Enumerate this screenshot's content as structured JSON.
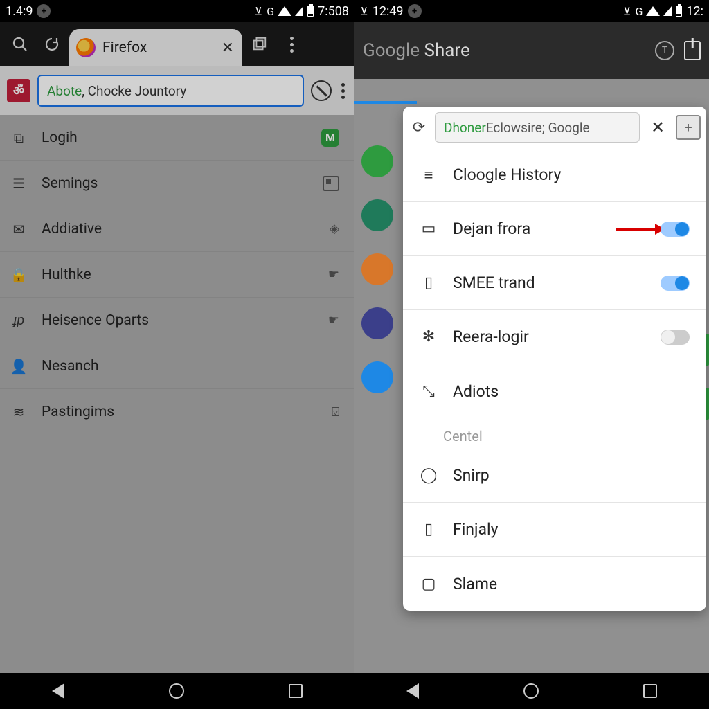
{
  "left": {
    "status": {
      "time_left": "1.4:9",
      "time_right": "7:508"
    },
    "tab": {
      "title": "Firefox"
    },
    "url": {
      "abote": "Abote",
      "rest": ", Chocke Jountory"
    },
    "items": [
      {
        "icon": "⧉",
        "label": "Logih",
        "right_type": "m"
      },
      {
        "icon": "☰",
        "label": "Semings",
        "right_type": "box"
      },
      {
        "icon": "✉",
        "label": "Addiative",
        "right_type": "diamond"
      },
      {
        "icon": "🔒",
        "label": "Hulthke",
        "right_type": "hand"
      },
      {
        "icon": "ɟp",
        "label": "Heisence Oparts",
        "right_type": "hand"
      },
      {
        "icon": "👤",
        "label": "Nesanch",
        "right_type": ""
      },
      {
        "icon": "≋",
        "label": "Pastingims",
        "right_type": "boxv"
      }
    ]
  },
  "right": {
    "status": {
      "time_left": "12:49",
      "time_right": "12:"
    },
    "header": {
      "google": "Google",
      "share": " Share"
    },
    "popup": {
      "url_green": "Dhoner",
      "url_rest": " Eclowsire; Google",
      "section": "Centel",
      "items_top": [
        {
          "icon": "≡",
          "label": "Cloogle History",
          "toggle": ""
        },
        {
          "icon": "▭",
          "label": "Dejan frora",
          "toggle": "on",
          "arrow": true
        },
        {
          "icon": "▯",
          "label": "SMEE trand",
          "toggle": "on"
        },
        {
          "icon": "✻",
          "label": "Reera-logir",
          "toggle": "off"
        },
        {
          "icon": "⤡",
          "label": "Adiots",
          "toggle": ""
        }
      ],
      "items_bottom": [
        {
          "icon": "◯",
          "label": "Snirp"
        },
        {
          "icon": "▯",
          "label": "Finjaly"
        },
        {
          "icon": "▢",
          "label": "Slame"
        }
      ]
    }
  }
}
